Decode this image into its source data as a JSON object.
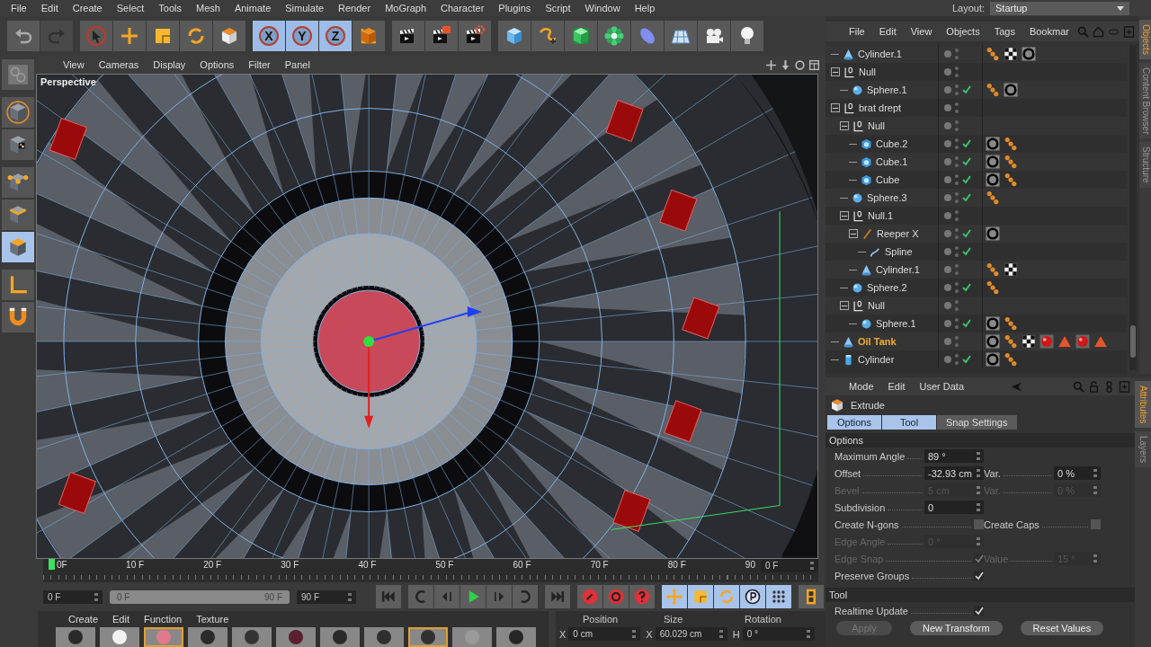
{
  "menu_bar": {
    "items": [
      "File",
      "Edit",
      "Create",
      "Select",
      "Tools",
      "Mesh",
      "Animate",
      "Simulate",
      "Render",
      "MoGraph",
      "Character",
      "Plugins",
      "Script",
      "Window",
      "Help"
    ],
    "layout_label": "Layout:",
    "layout_value": "Startup"
  },
  "toolbar": {
    "history": [
      {
        "disabled": false
      },
      {
        "disabled": true
      }
    ],
    "axis_locks": [
      {
        "label": "X",
        "selected": true
      },
      {
        "label": "Y",
        "selected": true
      },
      {
        "label": "Z",
        "selected": true
      }
    ]
  },
  "mode_strip": [
    {
      "selected": false
    },
    {
      "selected": false
    },
    {
      "selected": false
    },
    {
      "selected": false
    },
    {
      "selected": false
    },
    {
      "selected": true
    },
    {
      "selected": false
    },
    {
      "selected": false
    }
  ],
  "viewport": {
    "menu": [
      "View",
      "Cameras",
      "Display",
      "Options",
      "Filter",
      "Panel"
    ],
    "label": "Perspective"
  },
  "timeline": {
    "ruler_labels": [
      "0F",
      "10 F",
      "20 F",
      "30 F",
      "40 F",
      "50 F",
      "60 F",
      "70 F",
      "80 F",
      "90"
    ],
    "current_frame": "0 F"
  },
  "transport": {
    "start": "0 F",
    "range_start": "0 F",
    "range_end": "90 F",
    "level": 1,
    "end": "90 F"
  },
  "material_manager": {
    "menu": [
      "Create",
      "Edit",
      "Function",
      "Texture"
    ],
    "thumbnails": [
      {
        "color": "#2a2a2a",
        "selected": false
      },
      {
        "color": "#f2f2f2",
        "selected": false
      },
      {
        "color": "#e07a8a",
        "selected": true
      },
      {
        "color": "#2a2a2a",
        "selected": false
      },
      {
        "color": "#333333",
        "selected": false
      },
      {
        "color": "#5a2030",
        "selected": false
      },
      {
        "color": "#2a2a2a",
        "selected": false
      },
      {
        "color": "#2e2e2e",
        "selected": false
      },
      {
        "color": "#303030",
        "selected": true
      },
      {
        "color": "#9a9a9a",
        "selected": false
      },
      {
        "color": "#262626",
        "selected": false
      }
    ]
  },
  "coordinates": {
    "headers": [
      "Position",
      "Size",
      "Rotation"
    ],
    "fields": [
      {
        "axis": "X",
        "value": "0 cm"
      },
      {
        "axis": "X",
        "value": "60.029 cm"
      },
      {
        "axis": "H",
        "value": "0 °"
      }
    ]
  },
  "object_manager": {
    "menu": [
      "File",
      "Edit",
      "View",
      "Objects",
      "Tags",
      "Bookmar"
    ],
    "side_tabs": [
      {
        "label": "Objects",
        "selected": true
      },
      {
        "label": "Content Browser",
        "selected": false
      },
      {
        "label": "Structure",
        "selected": false
      }
    ],
    "tree": [
      {
        "name": "Cylinder.1",
        "kind": "cone",
        "checked": false,
        "selected": false,
        "tags": [
          {
            "kind": "phong"
          },
          {
            "kind": "texture"
          },
          {
            "kind": "material"
          }
        ]
      },
      {
        "name": "Null",
        "kind": "null",
        "checked": false,
        "selected": false,
        "expanded": true,
        "children": [
          {
            "name": "Sphere.1",
            "kind": "sphere",
            "checked": true,
            "selected": false,
            "tags": [
              {
                "kind": "phong"
              },
              {
                "kind": "material"
              }
            ]
          }
        ]
      },
      {
        "name": "brat drept",
        "kind": "null",
        "checked": false,
        "selected": false,
        "expanded": true,
        "children": [
          {
            "name": "Null",
            "kind": "null",
            "checked": false,
            "selected": false,
            "expanded": true,
            "children": [
              {
                "name": "Cube.2",
                "kind": "cube",
                "checked": true,
                "selected": false,
                "tags": [
                  {
                    "kind": "material"
                  },
                  {
                    "kind": "phong"
                  }
                ]
              },
              {
                "name": "Cube.1",
                "kind": "cube",
                "checked": true,
                "selected": false,
                "tags": [
                  {
                    "kind": "material"
                  },
                  {
                    "kind": "phong"
                  }
                ]
              },
              {
                "name": "Cube",
                "kind": "cube",
                "checked": true,
                "selected": false,
                "tags": [
                  {
                    "kind": "material"
                  },
                  {
                    "kind": "phong"
                  }
                ]
              }
            ]
          },
          {
            "name": "Sphere.3",
            "kind": "sphere",
            "checked": true,
            "selected": false,
            "tags": [
              {
                "kind": "phong"
              }
            ]
          },
          {
            "name": "Null.1",
            "kind": "null",
            "checked": false,
            "selected": false,
            "expanded": true,
            "children": [
              {
                "name": "Reeper X",
                "kind": "reeper",
                "checked": true,
                "selected": false,
                "expanded": true,
                "tags": [
                  {
                    "kind": "material"
                  }
                ],
                "children": [
                  {
                    "name": "Spline",
                    "kind": "spline",
                    "checked": true,
                    "selected": false
                  }
                ]
              },
              {
                "name": "Cylinder.1",
                "kind": "cone",
                "checked": false,
                "selected": false,
                "tags": [
                  {
                    "kind": "phong"
                  },
                  {
                    "kind": "texture"
                  }
                ]
              }
            ]
          },
          {
            "name": "Sphere.2",
            "kind": "sphere",
            "checked": true,
            "selected": false,
            "tags": [
              {
                "kind": "phong"
              }
            ]
          },
          {
            "name": "Null",
            "kind": "null",
            "checked": false,
            "selected": false,
            "expanded": true,
            "children": [
              {
                "name": "Sphere.1",
                "kind": "sphere",
                "checked": true,
                "selected": false,
                "tags": [
                  {
                    "kind": "material"
                  },
                  {
                    "kind": "phong"
                  }
                ]
              }
            ]
          }
        ]
      },
      {
        "name": "Oil Tank",
        "kind": "cone",
        "checked": false,
        "selected": true,
        "tags": [
          {
            "kind": "material"
          },
          {
            "kind": "phong"
          },
          {
            "kind": "texture"
          },
          {
            "kind": "ball"
          },
          {
            "kind": "warning"
          },
          {
            "kind": "ball"
          },
          {
            "kind": "warning"
          }
        ]
      },
      {
        "name": "Cylinder",
        "kind": "cylinder",
        "checked": true,
        "selected": false,
        "tags": [
          {
            "kind": "material"
          },
          {
            "kind": "phong"
          }
        ]
      }
    ]
  },
  "attributes": {
    "menu": [
      "Mode",
      "Edit",
      "User Data"
    ],
    "tool": "Extrude",
    "side_tabs": [
      {
        "label": "Attributes",
        "selected": true
      },
      {
        "label": "Layers",
        "selected": false
      }
    ],
    "tabs": [
      {
        "label": "Options",
        "selected": true
      },
      {
        "label": "Tool",
        "selected": true
      },
      {
        "label": "Snap Settings",
        "selected": false
      }
    ],
    "sections": [
      {
        "title": "Options",
        "rows": [
          [
            {
              "kind": "number",
              "label": "Maximum Angle",
              "value": "89 °",
              "disabled": false
            }
          ],
          [
            {
              "kind": "number",
              "label": "Offset",
              "value": "-32.93 cm",
              "disabled": false
            },
            {
              "kind": "number",
              "label": "Var.",
              "value": "0 %",
              "disabled": false
            }
          ],
          [
            {
              "kind": "number",
              "label": "Bevel",
              "value": "5 cm",
              "disabled": true
            },
            {
              "kind": "number",
              "label": "Var.",
              "value": "0 %",
              "disabled": true
            }
          ],
          [
            {
              "kind": "number",
              "label": "Subdivision",
              "value": "0",
              "disabled": false
            }
          ],
          [
            {
              "kind": "checkbox",
              "label": "Create N-gons",
              "checked": false,
              "disabled": false
            },
            {
              "kind": "checkbox",
              "label": "Create Caps",
              "checked": false,
              "disabled": false
            }
          ],
          [
            {
              "kind": "number",
              "label": "Edge Angle",
              "value": "0 °",
              "disabled": true
            }
          ],
          [
            {
              "kind": "checkbox",
              "label": "Edge Snap",
              "checked": true,
              "disabled": true
            },
            {
              "kind": "number",
              "label": "Value",
              "value": "15 °",
              "disabled": true
            }
          ],
          [
            {
              "kind": "checkbox",
              "label": "Preserve Groups",
              "checked": true,
              "disabled": false
            }
          ]
        ]
      },
      {
        "title": "Tool",
        "rows": [
          [
            {
              "kind": "checkbox",
              "label": "Realtime Update",
              "checked": true,
              "disabled": false
            }
          ]
        ]
      }
    ],
    "buttons": [
      {
        "label": "Apply",
        "disabled": true
      },
      {
        "label": "New Transform",
        "disabled": false
      },
      {
        "label": "Reset Values",
        "disabled": false
      }
    ]
  }
}
